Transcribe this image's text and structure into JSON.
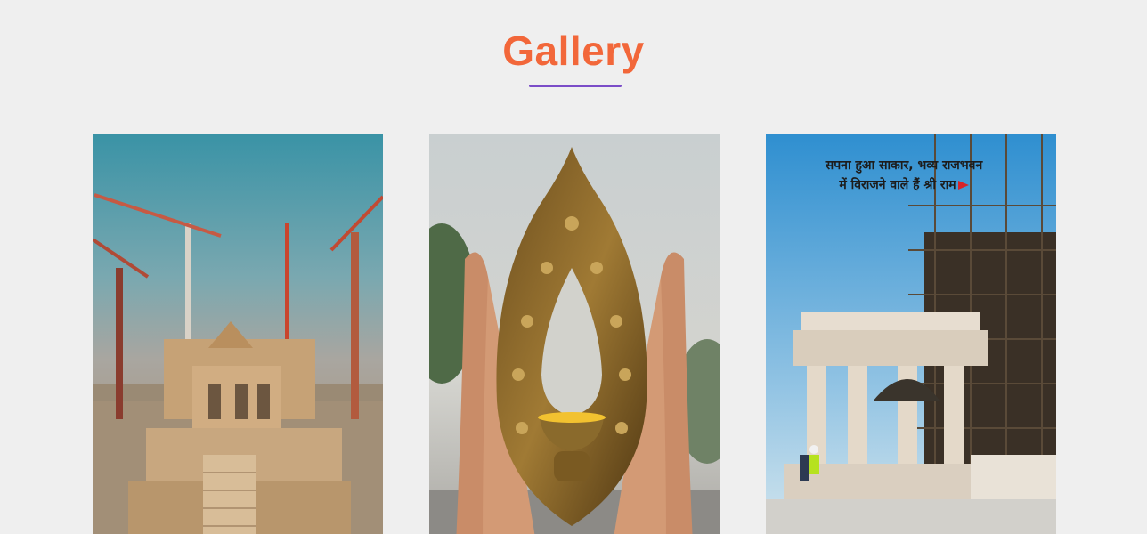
{
  "gallery": {
    "title": "Gallery",
    "colors": {
      "title": "#f2673a",
      "underline": "#7b4dc8",
      "background": "#efefef"
    },
    "images": [
      {
        "subject": "temple-construction-aerial-with-cranes"
      },
      {
        "subject": "hands-holding-ornate-lamp-frame"
      },
      {
        "subject": "temple-pillars-with-scaffolding",
        "caption_line1": "सपना हुआ साकार, भव्य राजभवन",
        "caption_line2": "में विराजने वाले हैं श्री राम"
      }
    ]
  }
}
